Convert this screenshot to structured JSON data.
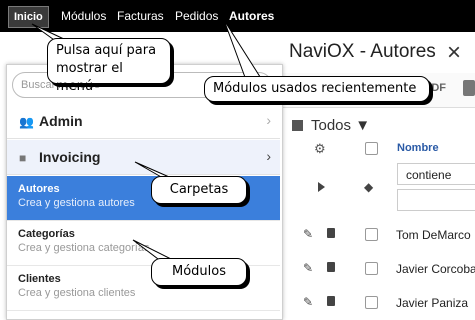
{
  "topbar": {
    "items": [
      "Inicio",
      "Módulos",
      "Facturas",
      "Pedidos",
      "Autores"
    ]
  },
  "main": {
    "title": "NaviOX - Autores",
    "close_icon": "close-icon",
    "toolbar": {
      "pdf_label": "PDF"
    },
    "list_header": "Todos ▼",
    "column_name": "Nombre",
    "filter": {
      "operator": "contiene",
      "value": ""
    },
    "rows": [
      "Tom DeMarco",
      "Javier Corcoba",
      "Javier Paniza"
    ]
  },
  "menu": {
    "search_placeholder": "Buscar módulos",
    "groups": [
      {
        "label": "Admin",
        "icon": "users-icon"
      },
      {
        "label": "Invoicing",
        "icon": "folder-icon"
      }
    ],
    "modules": [
      {
        "title": "Autores",
        "desc": "Crea y gestiona autores",
        "selected": true
      },
      {
        "title": "Categorías",
        "desc": "Crea y gestiona categorías",
        "selected": false
      },
      {
        "title": "Clientes",
        "desc": "Crea y gestiona clientes",
        "selected": false
      }
    ]
  },
  "callouts": {
    "menu_hint": "Pulsa aquí para mostrar el menú",
    "recent_modules": "Módulos usados recientemente",
    "folders": "Carpetas",
    "modules": "Módulos"
  },
  "colors": {
    "topbar_bg": "#000000",
    "selected_module": "#3b7fdc",
    "link_blue": "#2a5aa6"
  }
}
